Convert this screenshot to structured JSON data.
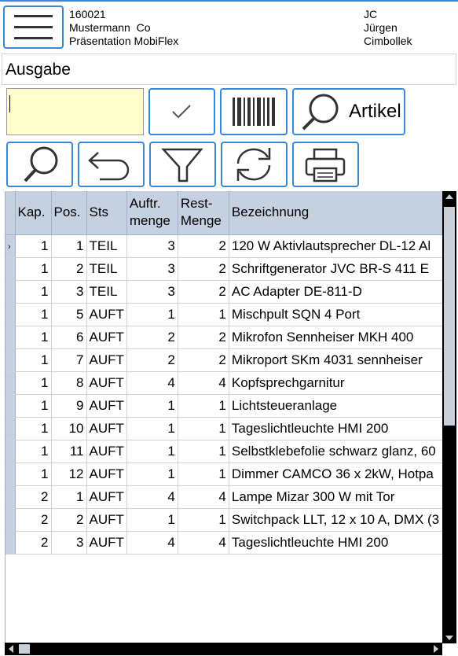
{
  "header": {
    "code": "160021",
    "company": "Mustermann  Co",
    "subtitle": "Präsentation MobiFlex",
    "user_initials": "JC",
    "user_first": "Jürgen",
    "user_last": "Cimbollek"
  },
  "page_title": "Ausgabe",
  "toolbar": {
    "input_value": "",
    "confirm_icon": "check-icon",
    "barcode_icon": "barcode-icon",
    "artikel_label": "Artikel",
    "search_icon": "search-icon",
    "back_icon": "undo-arrow-icon",
    "filter_icon": "funnel-icon",
    "refresh_icon": "refresh-icon",
    "print_icon": "printer-icon"
  },
  "colors": {
    "accent": "#3c86d8",
    "input_bg": "#ffffcc",
    "header_bg": "#c5d1e0"
  },
  "grid": {
    "columns": [
      "Kap.",
      "Pos.",
      "Sts",
      "Auftr.\nmenge",
      "Rest-\nMenge",
      "Bezeichnung"
    ],
    "rows": [
      [
        "1",
        "1",
        "TEIL",
        "3",
        "2",
        "120 W Aktivlautsprecher DL-12 Al"
      ],
      [
        "1",
        "2",
        "TEIL",
        "3",
        "2",
        "Schriftgenerator JVC BR-S 411 E"
      ],
      [
        "1",
        "3",
        "TEIL",
        "3",
        "2",
        "AC Adapter DE-811-D"
      ],
      [
        "1",
        "5",
        "AUFT",
        "1",
        "1",
        "Mischpult SQN 4 Port"
      ],
      [
        "1",
        "6",
        "AUFT",
        "2",
        "2",
        "Mikrofon Sennheiser MKH 400"
      ],
      [
        "1",
        "7",
        "AUFT",
        "2",
        "2",
        "Mikroport SKm 4031 sennheiser"
      ],
      [
        "1",
        "8",
        "AUFT",
        "4",
        "4",
        "Kopfsprechgarnitur"
      ],
      [
        "1",
        "9",
        "AUFT",
        "1",
        "1",
        "Lichtsteueranlage"
      ],
      [
        "1",
        "10",
        "AUFT",
        "1",
        "1",
        "Tageslichtleuchte HMI 200"
      ],
      [
        "1",
        "11",
        "AUFT",
        "1",
        "1",
        "Selbstklebefolie schwarz glanz, 60"
      ],
      [
        "1",
        "12",
        "AUFT",
        "1",
        "1",
        "Dimmer CAMCO 36 x 2kW, Hotpa"
      ],
      [
        "2",
        "1",
        "AUFT",
        "4",
        "4",
        "Lampe Mizar 300 W mit Tor"
      ],
      [
        "2",
        "2",
        "AUFT",
        "1",
        "1",
        "Switchpack LLT, 12 x 10 A, DMX (3"
      ],
      [
        "2",
        "3",
        "AUFT",
        "4",
        "4",
        "Tageslichtleuchte HMI 200"
      ]
    ]
  }
}
